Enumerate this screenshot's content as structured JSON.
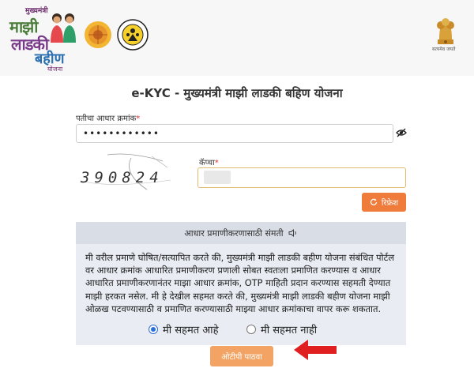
{
  "header": {
    "brand": {
      "line1": "मुख्यमंत्री",
      "line2": "माझी",
      "line3": "लाडकी",
      "line4": "बहीण",
      "line5": "योजना"
    },
    "emblem_caption": "सत्यमेव जयते"
  },
  "page": {
    "title": "e-KYC - मुख्यमंत्री माझी लाडकी बहिण योजना"
  },
  "form": {
    "aadhar_label": "पतीचा आधार क्रमांक",
    "required_mark": "*",
    "aadhar_value": "••••••••••••",
    "captcha_label": "कॅप्चा",
    "captcha_text": "390824",
    "refresh_label": "रिफ्रेश"
  },
  "consent": {
    "heading": "आधार प्रमाणीकरणासाठी संमती",
    "text": "मी वरील प्रमाणे घोषित/सत्यापित करते की, मुख्यमंत्री माझी लाडकी बहीण योजना संबंधित पोर्टल वर आधार क्रमांक आधारित प्रमाणीकरण प्रणाली सोबत स्वतःला प्रमाणित करण्यास व आधार आधारित प्रमाणीकरणानंतर माझा आधार क्रमांक, OTP माहिती प्रदान करण्यास सहमती देण्यात माझी हरकत नसेल. मी हे देखील सहमत करते की, मुख्यमंत्री माझी लाडकी बहीण योजना माझी ओळख पटवण्यासाठी व प्रमाणित करण्यासाठी माझ्या आधार क्रमांकाचा वापर करू शकतात.",
    "agree_label": "मी सहमत आहे",
    "disagree_label": "मी सहमत नाही",
    "agree_selected": true
  },
  "actions": {
    "send_otp_label": "ओटीपी पाठवा"
  },
  "colors": {
    "accent": "#f07c3c",
    "otp_button": "#f3a464",
    "consent_bg": "#e9edf3",
    "consent_head_bg": "#d8dde6",
    "radio": "#2b6fd6",
    "arrow": "#e02020"
  }
}
